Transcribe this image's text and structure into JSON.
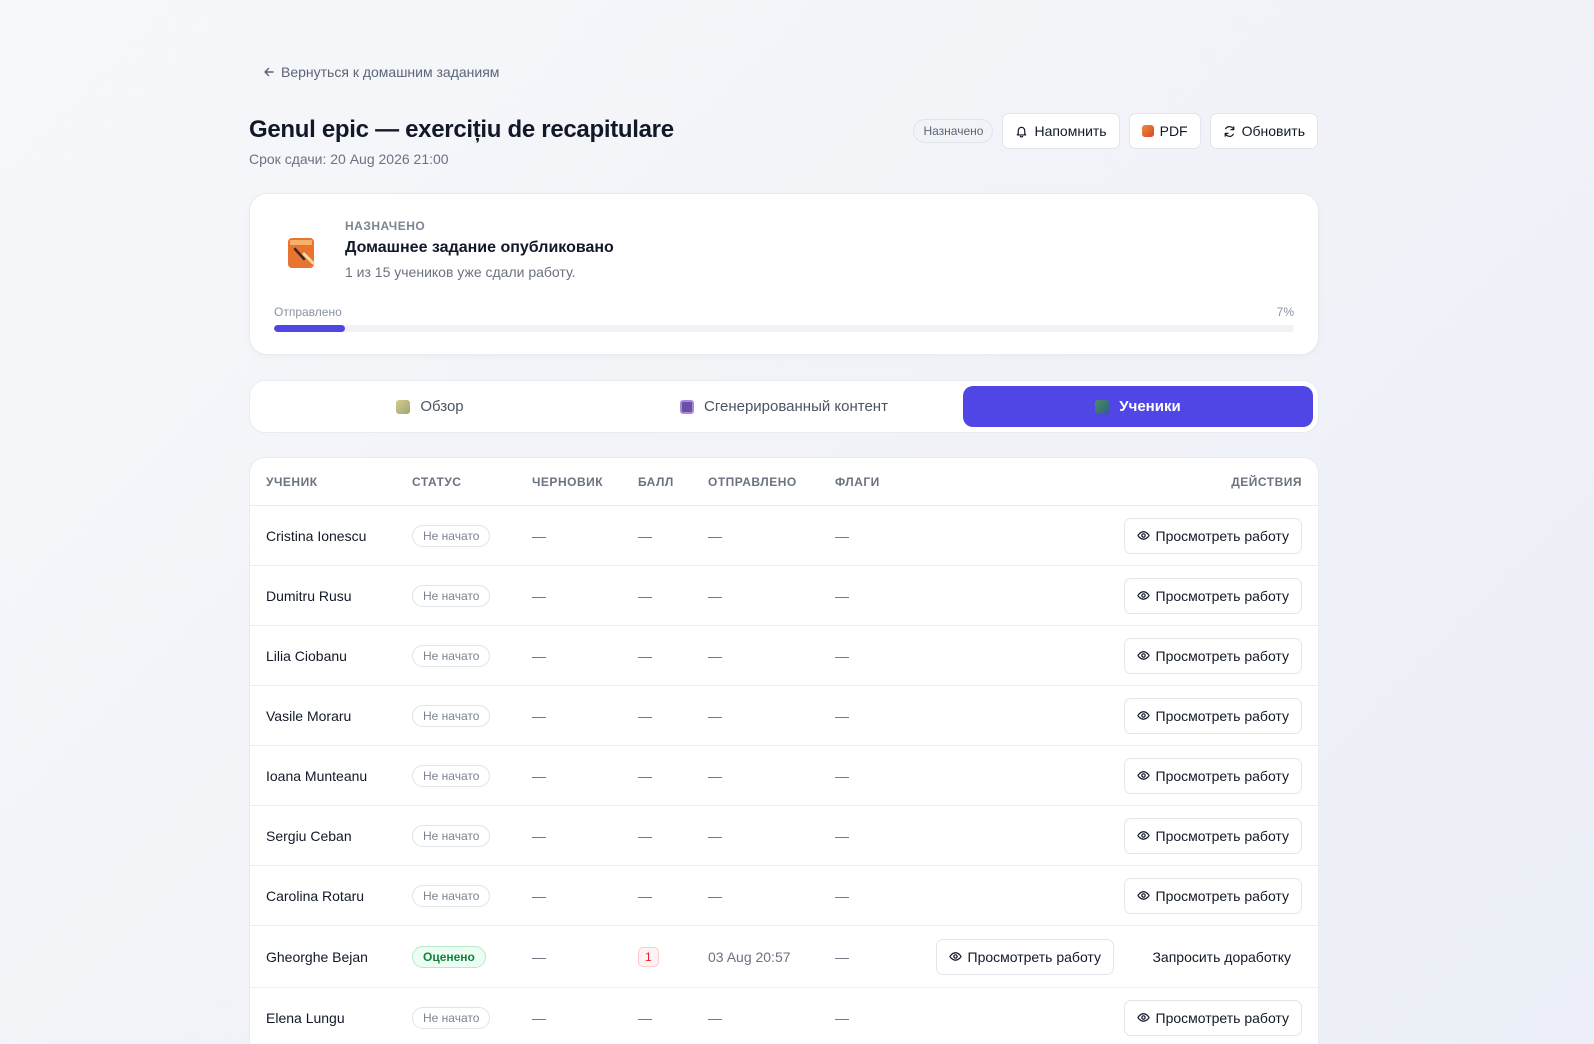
{
  "back_label": "Вернуться к домашним заданиям",
  "title": "Genul epic — exercițiu de recapitulare",
  "due": "Срок сдачи: 20 Aug 2026 21:00",
  "header": {
    "status_pill": "Назначено",
    "remind_label": "Напомнить",
    "pdf_label": "PDF",
    "refresh_label": "Обновить"
  },
  "summary": {
    "kicker": "НАЗНАЧЕНО",
    "heading": "Домашнее задание опубликовано",
    "subtext": "1 из 15 учеников уже сдали работу.",
    "progress_label": "Отправлено",
    "progress_pct_text": "7%",
    "progress_value": 0.07,
    "accent_color": "#4f46e5"
  },
  "tabs": [
    {
      "label": "Обзор",
      "icon": "overview-icon",
      "active": false
    },
    {
      "label": "Сгенерированный контент",
      "icon": "generated-content-icon",
      "active": false
    },
    {
      "label": "Ученики",
      "icon": "students-icon",
      "active": true
    }
  ],
  "table": {
    "columns": {
      "student": "УЧЕНИК",
      "status": "СТАТУС",
      "draft": "ЧЕРНОВИК",
      "score": "БАЛЛ",
      "sent": "ОТПРАВЛЕНО",
      "flags": "ФЛАГИ",
      "actions": "ДЕЙСТВИЯ"
    },
    "view_label": "Просмотреть работу",
    "rework_label": "Запросить доработку",
    "rows": [
      {
        "name": "Cristina Ionescu",
        "status": "Не начато",
        "draft": "—",
        "score": "—",
        "sent": "—",
        "flags": "—"
      },
      {
        "name": "Dumitru Rusu",
        "status": "Не начато",
        "draft": "—",
        "score": "—",
        "sent": "—",
        "flags": "—"
      },
      {
        "name": "Lilia Ciobanu",
        "status": "Не начато",
        "draft": "—",
        "score": "—",
        "sent": "—",
        "flags": "—"
      },
      {
        "name": "Vasile Moraru",
        "status": "Не начато",
        "draft": "—",
        "score": "—",
        "sent": "—",
        "flags": "—"
      },
      {
        "name": "Ioana Munteanu",
        "status": "Не начато",
        "draft": "—",
        "score": "—",
        "sent": "—",
        "flags": "—"
      },
      {
        "name": "Sergiu Ceban",
        "status": "Не начато",
        "draft": "—",
        "score": "—",
        "sent": "—",
        "flags": "—"
      },
      {
        "name": "Carolina Rotaru",
        "status": "Не начато",
        "draft": "—",
        "score": "—",
        "sent": "—",
        "flags": "—"
      },
      {
        "name": "Gheorghe Bejan",
        "status": "Оценено",
        "draft": "—",
        "score": "1",
        "sent": "03 Aug 20:57",
        "flags": "—",
        "graded": true
      },
      {
        "name": "Elena Lungu",
        "status": "Не начато",
        "draft": "—",
        "score": "—",
        "sent": "—",
        "flags": "—"
      }
    ]
  }
}
